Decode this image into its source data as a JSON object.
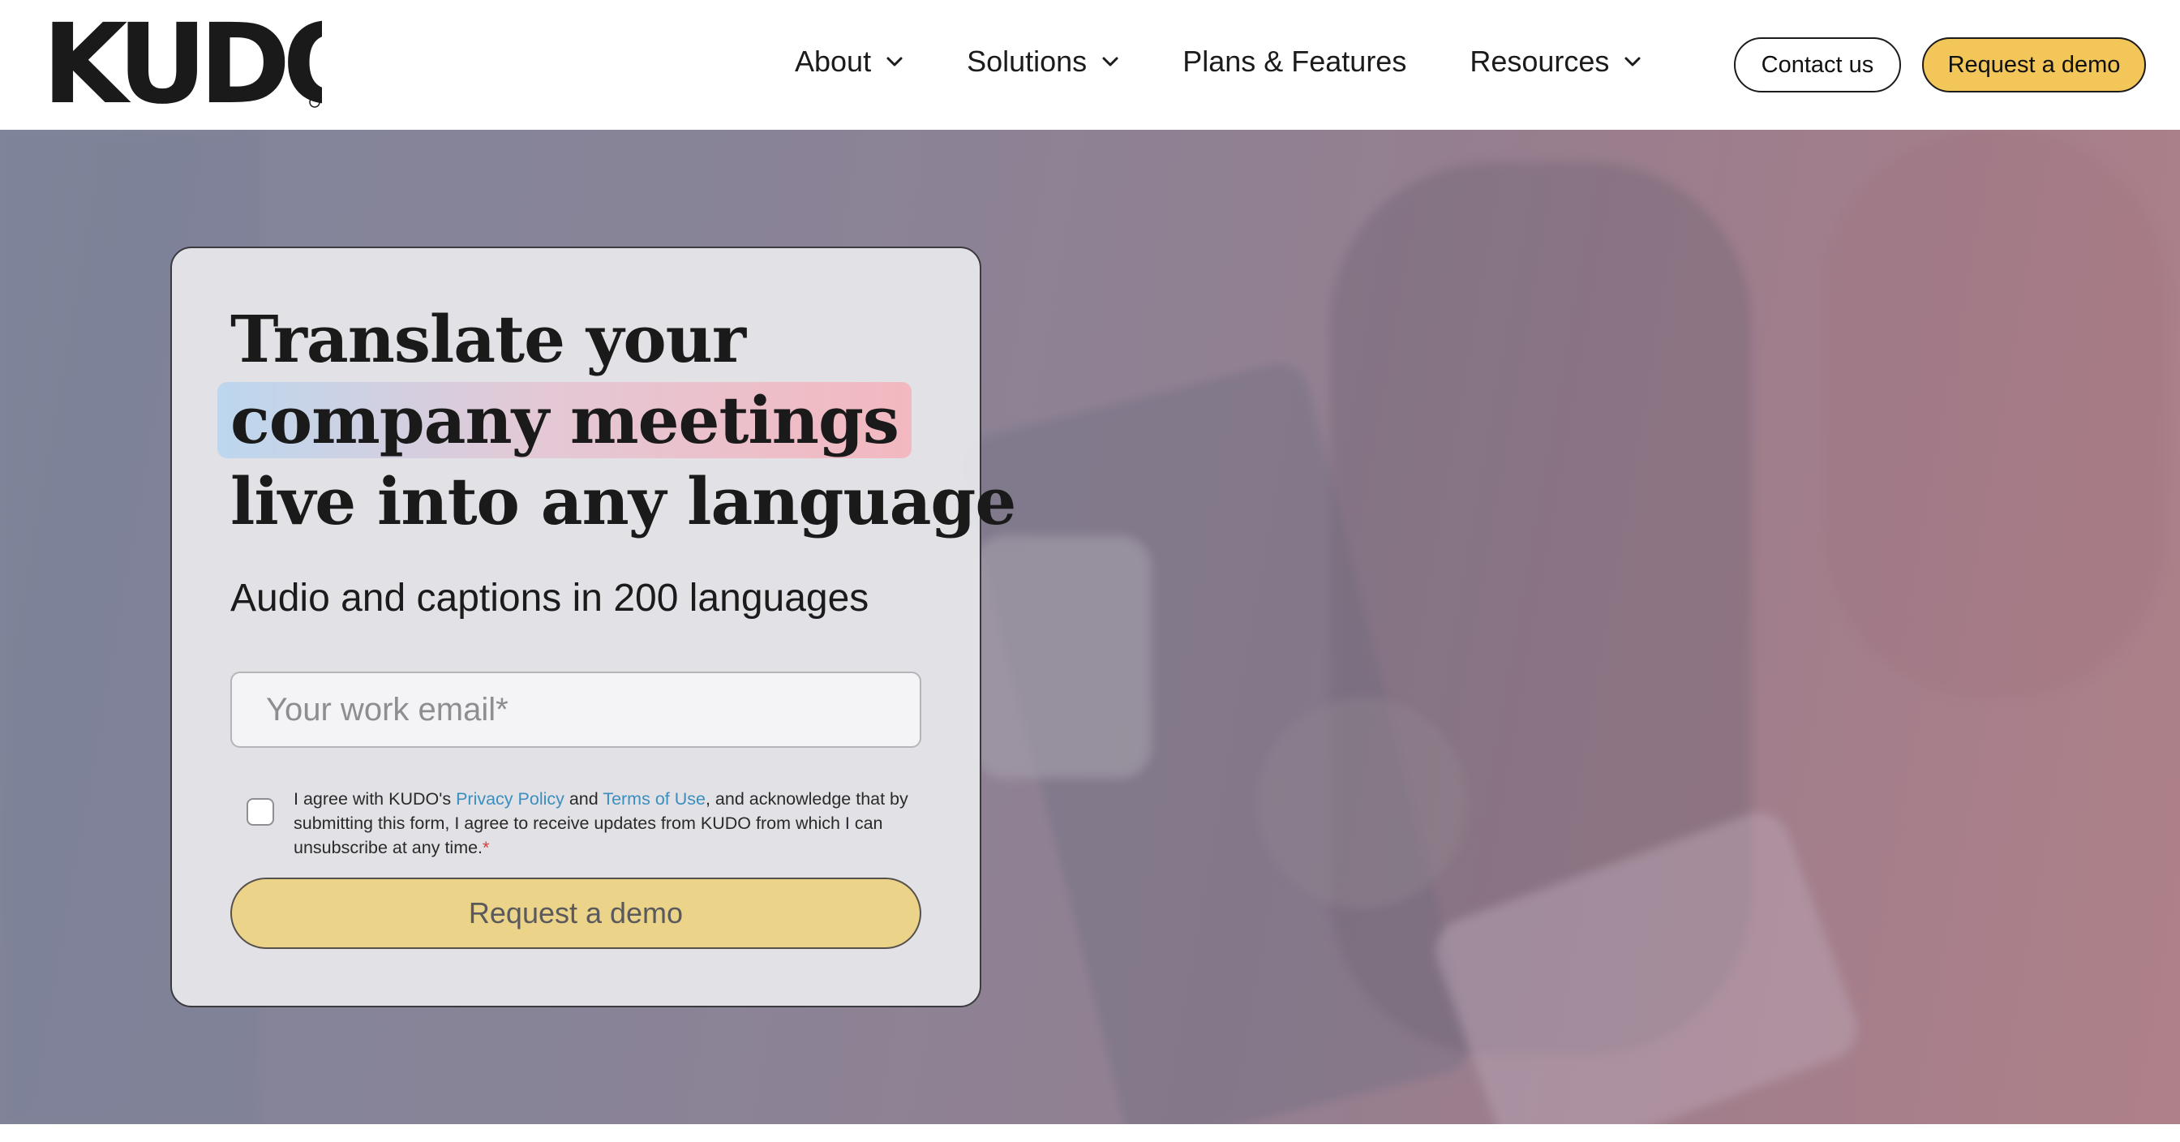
{
  "header": {
    "logo_text": "KUDO",
    "nav": [
      {
        "label": "About",
        "has_dropdown": true
      },
      {
        "label": "Solutions",
        "has_dropdown": true
      },
      {
        "label": "Plans & Features",
        "has_dropdown": false
      },
      {
        "label": "Resources",
        "has_dropdown": true
      }
    ],
    "contact_label": "Contact us",
    "demo_label": "Request a demo"
  },
  "hero": {
    "headline": {
      "line1": "Translate your",
      "line2_highlight": "company meetings",
      "line3": "live into any language"
    },
    "subheadline": "Audio and captions in 200 languages",
    "form": {
      "email_placeholder": "Your work email*",
      "email_value": "",
      "consent": {
        "text_before": "I agree with KUDO's ",
        "privacy_link": "Privacy Policy",
        "text_and": " and ",
        "terms_link": "Terms of Use",
        "text_after": ", and acknowledge that by submitting this form, I agree to receive updates from KUDO from which I can unsubscribe at any time.",
        "required_mark": "*",
        "checked": false
      },
      "submit_label": "Request a demo"
    }
  },
  "colors": {
    "accent_yellow": "#f2c659",
    "link_blue": "#3a8fbf",
    "required_red": "#d23c3c"
  }
}
